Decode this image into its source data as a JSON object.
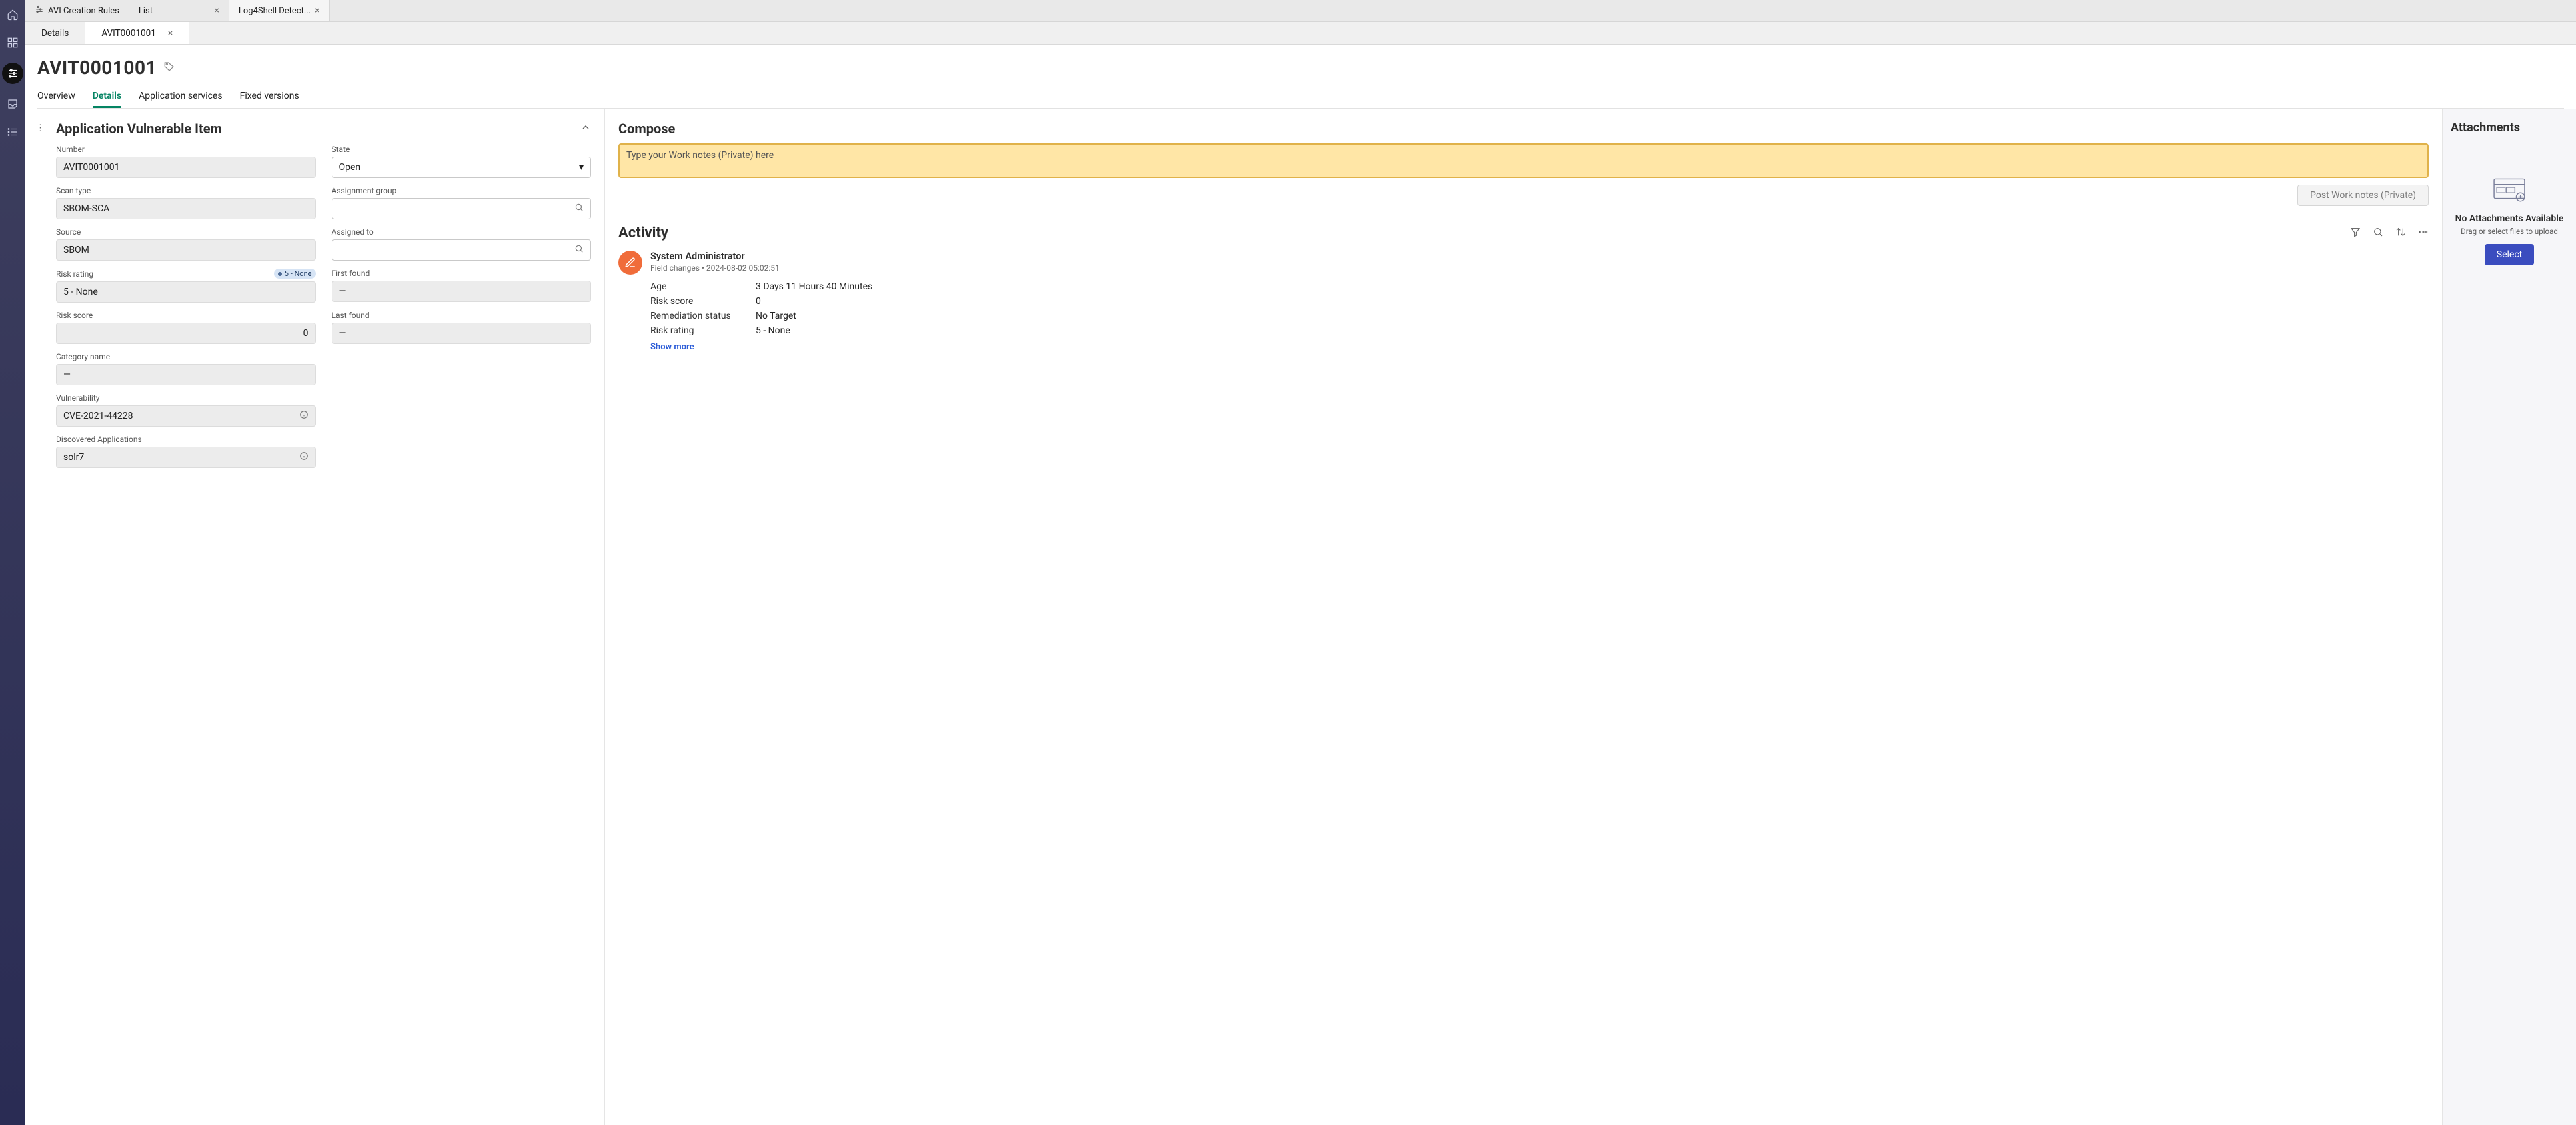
{
  "left_nav": {
    "items": [
      "home",
      "apps",
      "filters",
      "inbox",
      "list"
    ]
  },
  "top_tabs": [
    {
      "label": "AVI Creation Rules",
      "closable": false,
      "has_icon": true,
      "active": false
    },
    {
      "label": "List",
      "closable": true,
      "has_icon": false,
      "active": false
    },
    {
      "label": "Log4Shell Detect...",
      "closable": true,
      "has_icon": false,
      "active": true
    }
  ],
  "sub_tabs": [
    {
      "label": "Details",
      "closable": false,
      "active": false
    },
    {
      "label": "AVIT0001001",
      "closable": true,
      "active": true
    }
  ],
  "record": {
    "title": "AVIT0001001",
    "nav": [
      "Overview",
      "Details",
      "Application services",
      "Fixed versions"
    ],
    "active_nav": "Details",
    "section_title": "Application Vulnerable Item"
  },
  "fields": {
    "number": {
      "label": "Number",
      "value": "AVIT0001001"
    },
    "state": {
      "label": "State",
      "value": "Open"
    },
    "scan_type": {
      "label": "Scan type",
      "value": "SBOM-SCA"
    },
    "assignment_group": {
      "label": "Assignment group",
      "value": ""
    },
    "source": {
      "label": "Source",
      "value": "SBOM"
    },
    "assigned_to": {
      "label": "Assigned to",
      "value": ""
    },
    "risk_rating": {
      "label": "Risk rating",
      "value": "5 - None",
      "badge": "5 - None"
    },
    "first_found": {
      "label": "First found",
      "value": "—"
    },
    "risk_score": {
      "label": "Risk score",
      "value": "0"
    },
    "last_found": {
      "label": "Last found",
      "value": "—"
    },
    "category_name": {
      "label": "Category name",
      "value": "—"
    },
    "vulnerability": {
      "label": "Vulnerability",
      "value": "CVE-2021-44228"
    },
    "discovered_applications": {
      "label": "Discovered Applications",
      "value": "solr7"
    }
  },
  "compose": {
    "heading": "Compose",
    "placeholder": "Type your Work notes (Private) here",
    "post_label": "Post Work notes (Private)"
  },
  "activity": {
    "heading": "Activity",
    "entry": {
      "author": "System Administrator",
      "sub": "Field changes  •  2024-08-02 05:02:51",
      "rows": [
        {
          "k": "Age",
          "v": "3 Days 11 Hours 40 Minutes"
        },
        {
          "k": "Risk score",
          "v": "0"
        },
        {
          "k": "Remediation status",
          "v": "No Target"
        },
        {
          "k": "Risk rating",
          "v": "5 - None"
        }
      ],
      "show_more": "Show more"
    }
  },
  "attachments": {
    "heading": "Attachments",
    "empty_title": "No Attachments Available",
    "empty_sub": "Drag or select files to upload",
    "select_label": "Select"
  }
}
